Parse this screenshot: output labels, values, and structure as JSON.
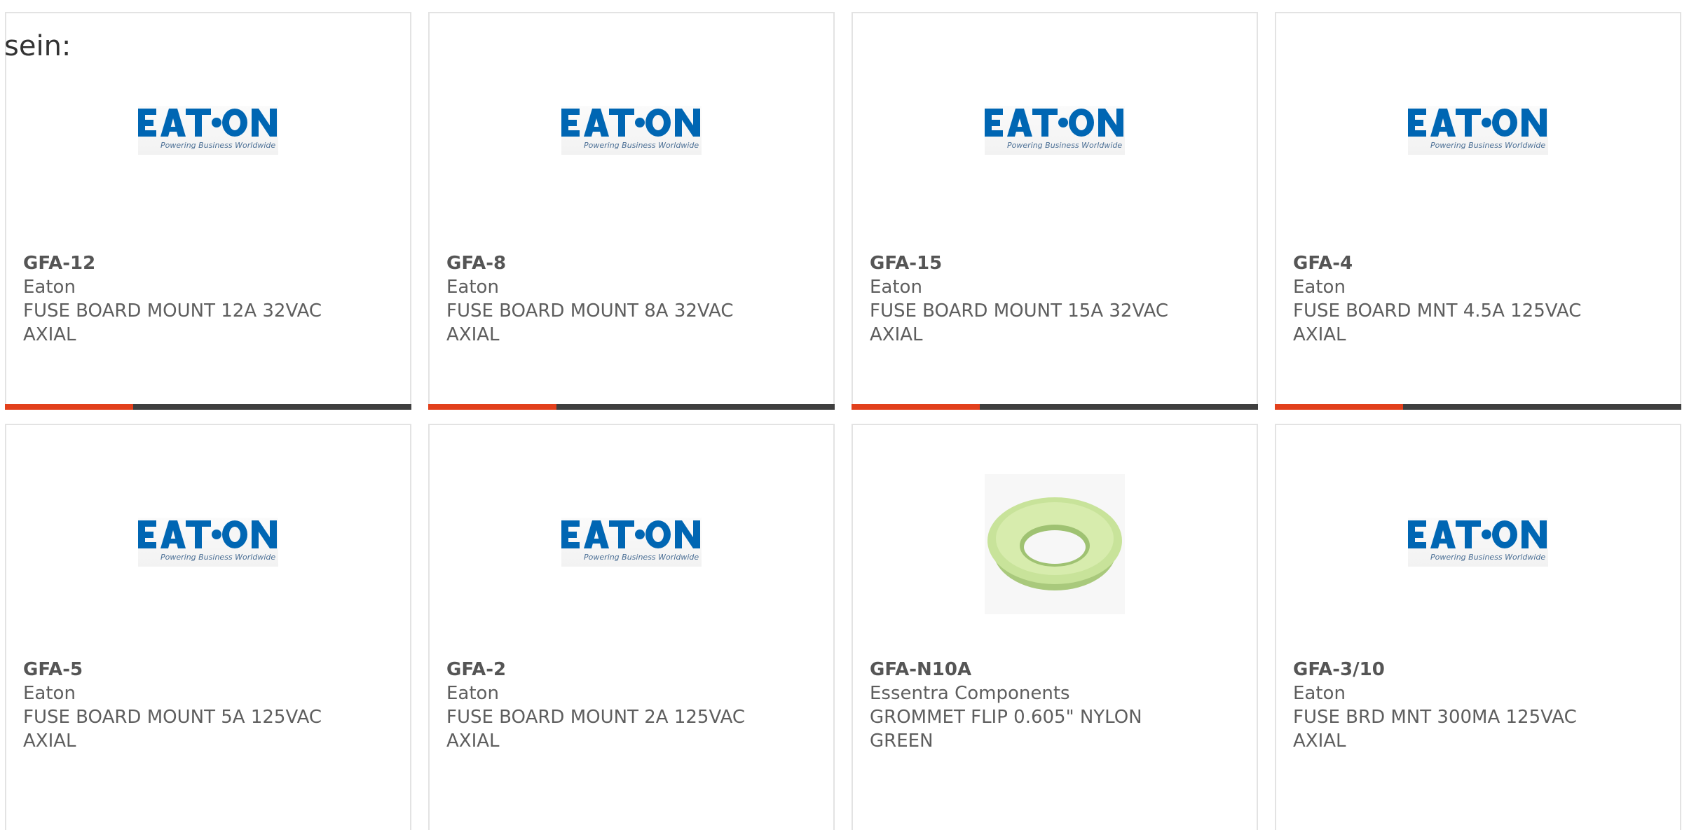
{
  "intro_text": "sein:",
  "brand_colors": {
    "eaton_blue": "#0066b3",
    "accent_orange": "#e2401c",
    "bar_gray": "#3f3f3f"
  },
  "eaton_logo": {
    "wordmark": "EATON",
    "tagline": "Powering Business Worldwide"
  },
  "products": [
    {
      "part_number": "GFA-12",
      "manufacturer": "Eaton",
      "desc_line1": "FUSE BOARD MOUNT 12A 32VAC",
      "desc_line2": "AXIAL",
      "image": "eaton-logo"
    },
    {
      "part_number": "GFA-8",
      "manufacturer": "Eaton",
      "desc_line1": "FUSE BOARD MOUNT 8A 32VAC",
      "desc_line2": "AXIAL",
      "image": "eaton-logo"
    },
    {
      "part_number": "GFA-15",
      "manufacturer": "Eaton",
      "desc_line1": "FUSE BOARD MOUNT 15A 32VAC",
      "desc_line2": "AXIAL",
      "image": "eaton-logo"
    },
    {
      "part_number": "GFA-4",
      "manufacturer": "Eaton",
      "desc_line1": "FUSE BOARD MNT 4.5A 125VAC",
      "desc_line2": "AXIAL",
      "image": "eaton-logo"
    },
    {
      "part_number": "GFA-5",
      "manufacturer": "Eaton",
      "desc_line1": "FUSE BOARD MOUNT 5A 125VAC",
      "desc_line2": "AXIAL",
      "image": "eaton-logo"
    },
    {
      "part_number": "GFA-2",
      "manufacturer": "Eaton",
      "desc_line1": "FUSE BOARD MOUNT 2A 125VAC",
      "desc_line2": "AXIAL",
      "image": "eaton-logo"
    },
    {
      "part_number": "GFA-N10A",
      "manufacturer": "Essentra Components",
      "desc_line1": "GROMMET FLIP 0.605\" NYLON",
      "desc_line2": "GREEN",
      "image": "green-grommet"
    },
    {
      "part_number": "GFA-3/10",
      "manufacturer": "Eaton",
      "desc_line1": "FUSE BRD MNT 300MA 125VAC",
      "desc_line2": "AXIAL",
      "image": "eaton-logo"
    }
  ]
}
